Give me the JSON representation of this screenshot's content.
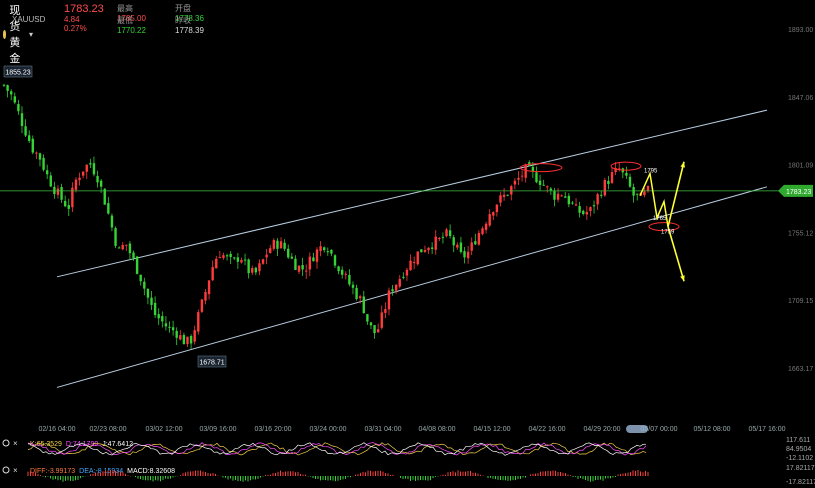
{
  "header": {
    "symbol_name": "现货黄金",
    "symbol_code": "XAUUSD",
    "last_price": "1783.23",
    "change": "4.84",
    "change_pct": "0.27%",
    "high_label": "最高",
    "high_value": "1785.00",
    "open_label": "开盘",
    "open_value": "1778.36",
    "low_label": "最低",
    "low_value": "1770.22",
    "prev_close_label": "昨收",
    "prev_close_value": "1778.39"
  },
  "chart_data": {
    "type": "candlestick",
    "symbol": "XAUUSD",
    "yaxis_ticks": [
      "1893.00",
      "1847.06",
      "1801.09",
      "1755.12",
      "1709.15",
      "1663.17"
    ],
    "ylim": [
      1640,
      1905
    ],
    "xaxis_ticks": [
      "02/16 04:00",
      "02/23 08:00",
      "03/02 12:00",
      "03/09 16:00",
      "03/16 20:00",
      "03/24 00:00",
      "03/31 04:00",
      "04/08 08:00",
      "04/15 12:00",
      "04/22 16:00",
      "04/29 20:00",
      "05/07 00:00",
      "05/12 08:00",
      "05/17 16:00"
    ],
    "current_price_tag": "1783.23",
    "annotations": [
      "1855.23",
      "1678.71",
      "1795",
      "1765",
      "1759"
    ],
    "path": [
      1855,
      1848,
      1836,
      1824,
      1812,
      1806,
      1794,
      1785,
      1778,
      1772,
      1790,
      1798,
      1802,
      1794,
      1778,
      1760,
      1742,
      1748,
      1737,
      1726,
      1712,
      1700,
      1695,
      1690,
      1688,
      1682,
      1680,
      1696,
      1712,
      1730,
      1742,
      1738,
      1734,
      1740,
      1730,
      1726,
      1734,
      1744,
      1748,
      1746,
      1738,
      1732,
      1730,
      1738,
      1744,
      1748,
      1738,
      1730,
      1722,
      1715,
      1708,
      1692,
      1686,
      1700,
      1716,
      1722,
      1730,
      1736,
      1742,
      1746,
      1748,
      1750,
      1754,
      1746,
      1738,
      1742,
      1752,
      1760,
      1770,
      1776,
      1780,
      1786,
      1792,
      1798,
      1794,
      1790,
      1784,
      1780,
      1782,
      1776,
      1770,
      1768,
      1770,
      1780,
      1788,
      1794,
      1798,
      1790,
      1780,
      1778,
      1783
    ],
    "channel": {
      "upper": {
        "from": [
          "02/16 04:00",
          1725
        ],
        "to": [
          "05/17 16:00",
          1838
        ]
      },
      "lower": {
        "from": [
          "02/16 04:00",
          1650
        ],
        "to": [
          "05/17 16:00",
          1786
        ]
      }
    },
    "indicators": {
      "kdj": {
        "K": "65.3529",
        "D": "74.1790",
        "J": "47.6412",
        "labels": [
          "K:",
          "D:",
          "J:"
        ],
        "ticks": [
          "117.611",
          "84.9504",
          "-12.1102"
        ]
      },
      "macd": {
        "DIFF": "-3.99173",
        "DEA": "-8.15934",
        "MACD": "8.32608",
        "labels": [
          "DIFF:",
          "DEA:",
          "MACD:"
        ],
        "ticks": [
          "17.82117",
          "-17.82117"
        ]
      }
    }
  },
  "colors": {
    "up": "#ff3b3b",
    "down": "#35d335",
    "channel": "#b8cde0",
    "hline": "#3fbf3f",
    "arrow": "#ffff33",
    "ellipse": "#ff3030"
  }
}
